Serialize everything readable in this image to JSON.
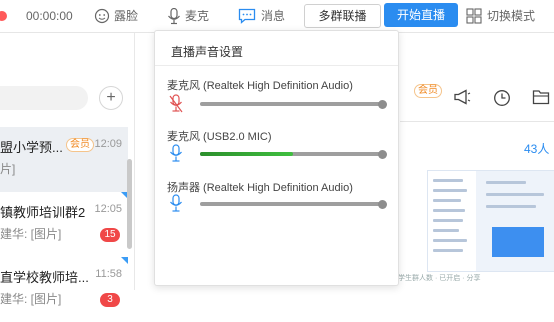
{
  "toolbar": {
    "timer": "00:00:00",
    "beauty_label": "露脸",
    "mic_label": "麦克",
    "message_label": "消息",
    "multi_group_label": "多群联播",
    "start_live_label": "开始直播",
    "switch_mode_label": "切换模式"
  },
  "chat_list": {
    "add_icon": "+",
    "items": [
      {
        "name": "盟小学预...",
        "vip": "会员",
        "time": "12:09",
        "preview": "片]",
        "badge": "",
        "selected": true
      },
      {
        "name": "镇教师培训群2",
        "vip": "",
        "time": "12:05",
        "preview": "建华: [图片]",
        "badge": "15",
        "selected": false
      },
      {
        "name": "直学校教师培...",
        "vip": "",
        "time": "11:58",
        "preview": "建华: [图片]",
        "badge": "3",
        "selected": false
      }
    ]
  },
  "right_pane": {
    "vip": "会员",
    "count": "43人",
    "bottom_text": "学生群人数 · 已开启 · 分享"
  },
  "popup": {
    "title": "直播声音设置",
    "devices": [
      {
        "label": "麦克风 (Realtek High Definition Audio)",
        "icon": "mic-muted-icon",
        "level": 0,
        "volume": 1.0
      },
      {
        "label": "麦克风 (USB2.0 MIC)",
        "icon": "mic-icon",
        "level": 0.51,
        "volume": 1.0
      },
      {
        "label": "扬声器 (Realtek High Definition Audio)",
        "icon": "mic-icon",
        "level": 0,
        "volume": 1.0
      }
    ]
  },
  "colors": {
    "accent": "#2a8cf0",
    "badge": "#f04848",
    "vip": "#f08a24",
    "level_green": "#3fbf3f"
  }
}
